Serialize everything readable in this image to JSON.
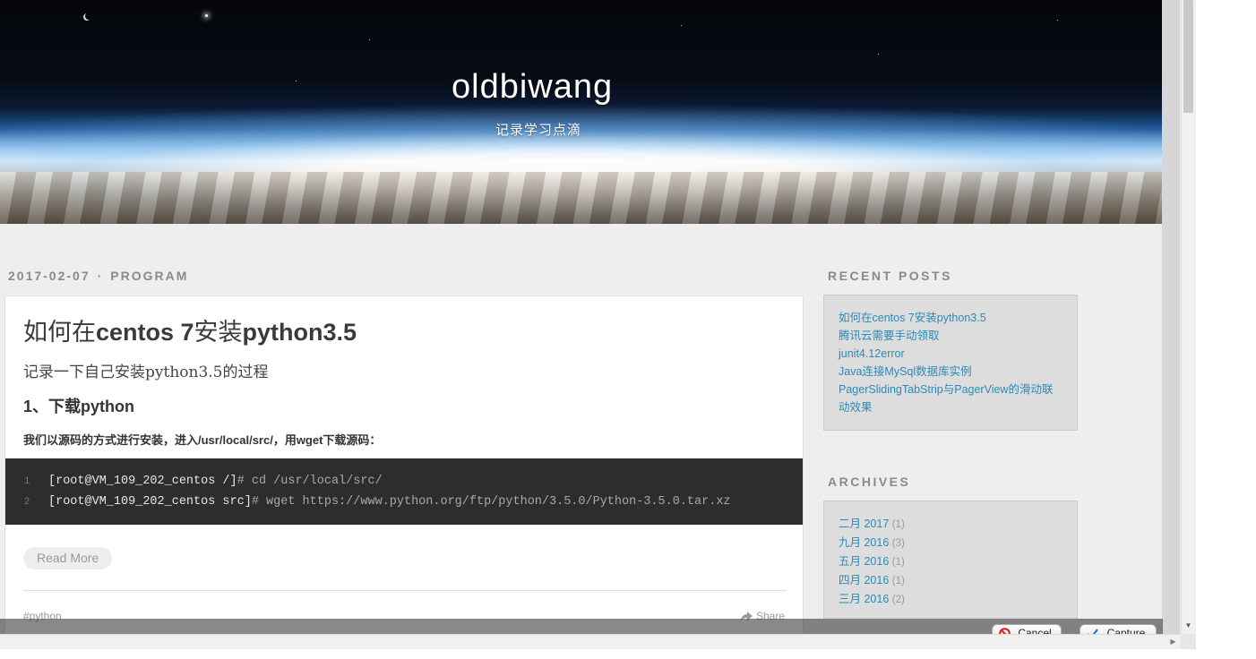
{
  "site": {
    "title": "oldbiwang",
    "subtitle": "记录学习点滴"
  },
  "post": {
    "date": "2017-02-07",
    "separator": "·",
    "category": "PROGRAM",
    "title_prefix": "如何在",
    "title_main": "centos 7",
    "title_mid": "安装",
    "title_end": "python3.5",
    "lead": "记录一下自己安装python3.5的过程",
    "heading": "1、下载python",
    "paragraph": "我们以源码的方式进行安装，进入/usr/local/src/，用wget下载源码：",
    "code": [
      {
        "num": "1",
        "prompt": "[root@VM_109_202_centos /]",
        "cmd": "# cd /usr/local/src/"
      },
      {
        "num": "2",
        "prompt": "[root@VM_109_202_centos src]",
        "cmd": "# wget https://www.python.org/ftp/python/3.5.0/Python-3.5.0.tar.xz"
      }
    ],
    "read_more": "Read More",
    "tag": "#python",
    "share": "Share"
  },
  "sidebar": {
    "recent_title": "RECENT POSTS",
    "recent_posts": [
      "如何在centos 7安装python3.5",
      "腾讯云需要手动领取",
      "junit4.12error",
      "Java连接MySql数据库实例",
      "PagerSlidingTabStrip与PagerView的滑动联动效果"
    ],
    "archives_title": "ARCHIVES",
    "archives": [
      {
        "label": "二月 2017",
        "count": "(1)"
      },
      {
        "label": "九月 2016",
        "count": "(3)"
      },
      {
        "label": "五月 2016",
        "count": "(1)"
      },
      {
        "label": "四月 2016",
        "count": "(1)"
      },
      {
        "label": "三月 2016",
        "count": "(2)"
      }
    ]
  },
  "capture_bar": {
    "cancel": "Cancel",
    "capture": "Capture"
  },
  "icons": {
    "share": "share-arrow-icon",
    "cancel": "no-entry-icon",
    "capture": "checkmark-icon",
    "scroll_down": "triangle-down",
    "scroll_right": "triangle-right"
  },
  "colors": {
    "link": "#2a8ab8",
    "code_bg": "#2d2d2d",
    "page_bg": "#eeeeee"
  }
}
